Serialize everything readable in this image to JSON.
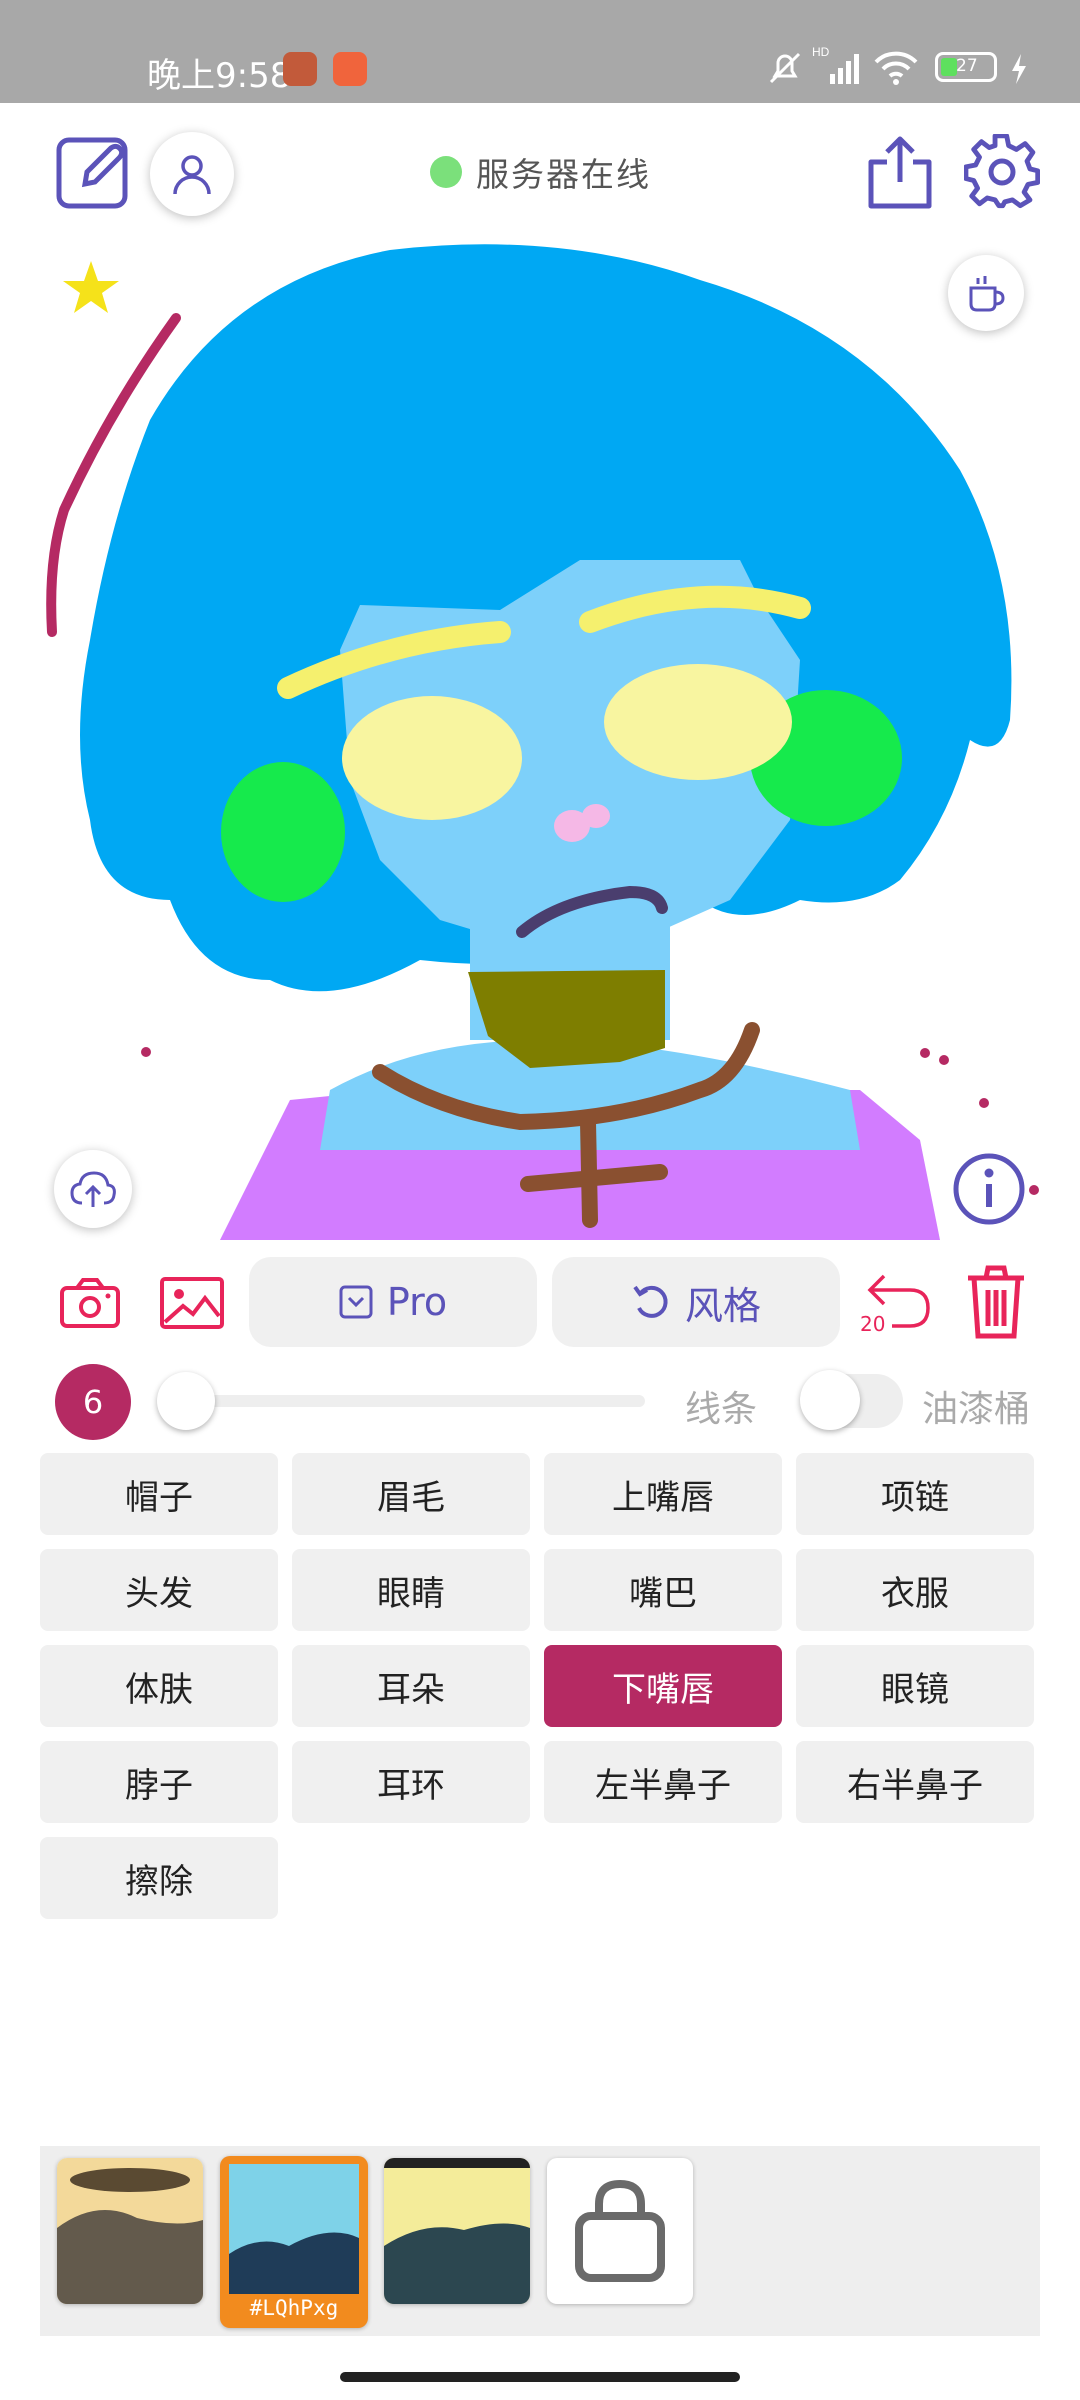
{
  "status_bar": {
    "time": "晚上9:58",
    "battery": "27",
    "network": "HD"
  },
  "toolbar": {
    "server_status": "服务器在线",
    "server_status_color": "#7be07b"
  },
  "controls": {
    "mode_label": "Pro",
    "style_label": "风格",
    "undo_count": "20"
  },
  "brush": {
    "size": "6",
    "size_fraction": 0.0,
    "line_label": "线条",
    "bucket_label": "油漆桶",
    "bucket_enabled": false
  },
  "parts": [
    {
      "label": "帽子",
      "selected": false
    },
    {
      "label": "眉毛",
      "selected": false
    },
    {
      "label": "上嘴唇",
      "selected": false
    },
    {
      "label": "项链",
      "selected": false
    },
    {
      "label": "头发",
      "selected": false
    },
    {
      "label": "眼睛",
      "selected": false
    },
    {
      "label": "嘴巴",
      "selected": false
    },
    {
      "label": "衣服",
      "selected": false
    },
    {
      "label": "体肤",
      "selected": false
    },
    {
      "label": "耳朵",
      "selected": false
    },
    {
      "label": "下嘴唇",
      "selected": true
    },
    {
      "label": "眼镜",
      "selected": false
    },
    {
      "label": "脖子",
      "selected": false
    },
    {
      "label": "耳环",
      "selected": false
    },
    {
      "label": "左半鼻子",
      "selected": false
    },
    {
      "label": "右半鼻子",
      "selected": false
    },
    {
      "label": "擦除",
      "selected": false
    }
  ],
  "styles": {
    "selected_code": "#LQhPxg"
  },
  "colors": {
    "accent": "#b52a63",
    "primary": "#5b53b9",
    "danger": "#e8245a",
    "hair": "#00a8f3",
    "skin": "#7dd0fa"
  }
}
